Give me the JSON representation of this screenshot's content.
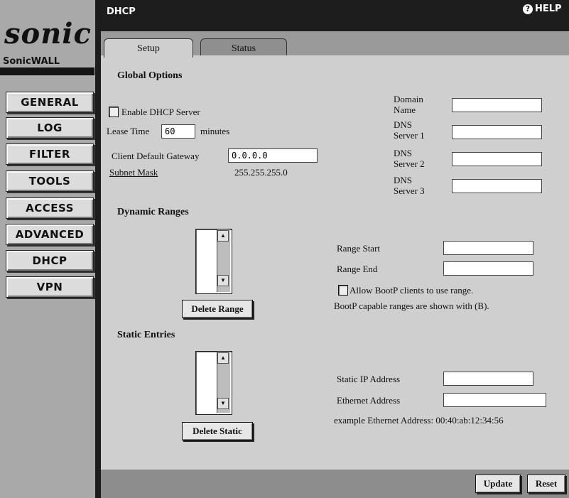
{
  "brand": {
    "logo": "sonic",
    "name": "SonicWALL"
  },
  "sidebar": {
    "items": [
      {
        "label": "GENERAL"
      },
      {
        "label": "LOG"
      },
      {
        "label": "FILTER"
      },
      {
        "label": "TOOLS"
      },
      {
        "label": "ACCESS"
      },
      {
        "label": "ADVANCED"
      },
      {
        "label": "DHCP"
      },
      {
        "label": "VPN"
      }
    ]
  },
  "header": {
    "title": "DHCP",
    "help_label": "HELP",
    "help_icon": "help-circle-icon"
  },
  "tabs": [
    {
      "label": "Setup",
      "active": true
    },
    {
      "label": "Status",
      "active": false
    }
  ],
  "global_options": {
    "heading": "Global Options",
    "enable_label": "Enable DHCP Server",
    "enable_checked": false,
    "lease_label": "Lease Time",
    "lease_value": "60",
    "lease_unit": "minutes",
    "gateway_label": "Client Default Gateway",
    "gateway_value": "0.0.0.0",
    "subnet_label": "Subnet Mask",
    "subnet_value": "255.255.255.0",
    "domain_label_1": "Domain",
    "domain_label_2": "Name",
    "domain_value": "",
    "dns": [
      {
        "label_1": "DNS",
        "label_2": "Server 1",
        "value": ""
      },
      {
        "label_1": "DNS",
        "label_2": "Server 2",
        "value": ""
      },
      {
        "label_1": "DNS",
        "label_2": "Server 3",
        "value": ""
      }
    ]
  },
  "dynamic_ranges": {
    "heading": "Dynamic Ranges",
    "delete_label": "Delete Range",
    "range_start_label": "Range Start",
    "range_start_value": "",
    "range_end_label": "Range End",
    "range_end_value": "",
    "bootp_label": "Allow BootP clients to use range.",
    "bootp_checked": false,
    "bootp_note": "BootP capable ranges are shown with (B)."
  },
  "static_entries": {
    "heading": "Static Entries",
    "delete_label": "Delete Static",
    "ip_label": "Static IP Address",
    "ip_value": "",
    "mac_label": "Ethernet Address",
    "mac_value": "",
    "example": "example Ethernet Address: 00:40:ab:12:34:56"
  },
  "footer": {
    "update_label": "Update",
    "reset_label": "Reset"
  }
}
